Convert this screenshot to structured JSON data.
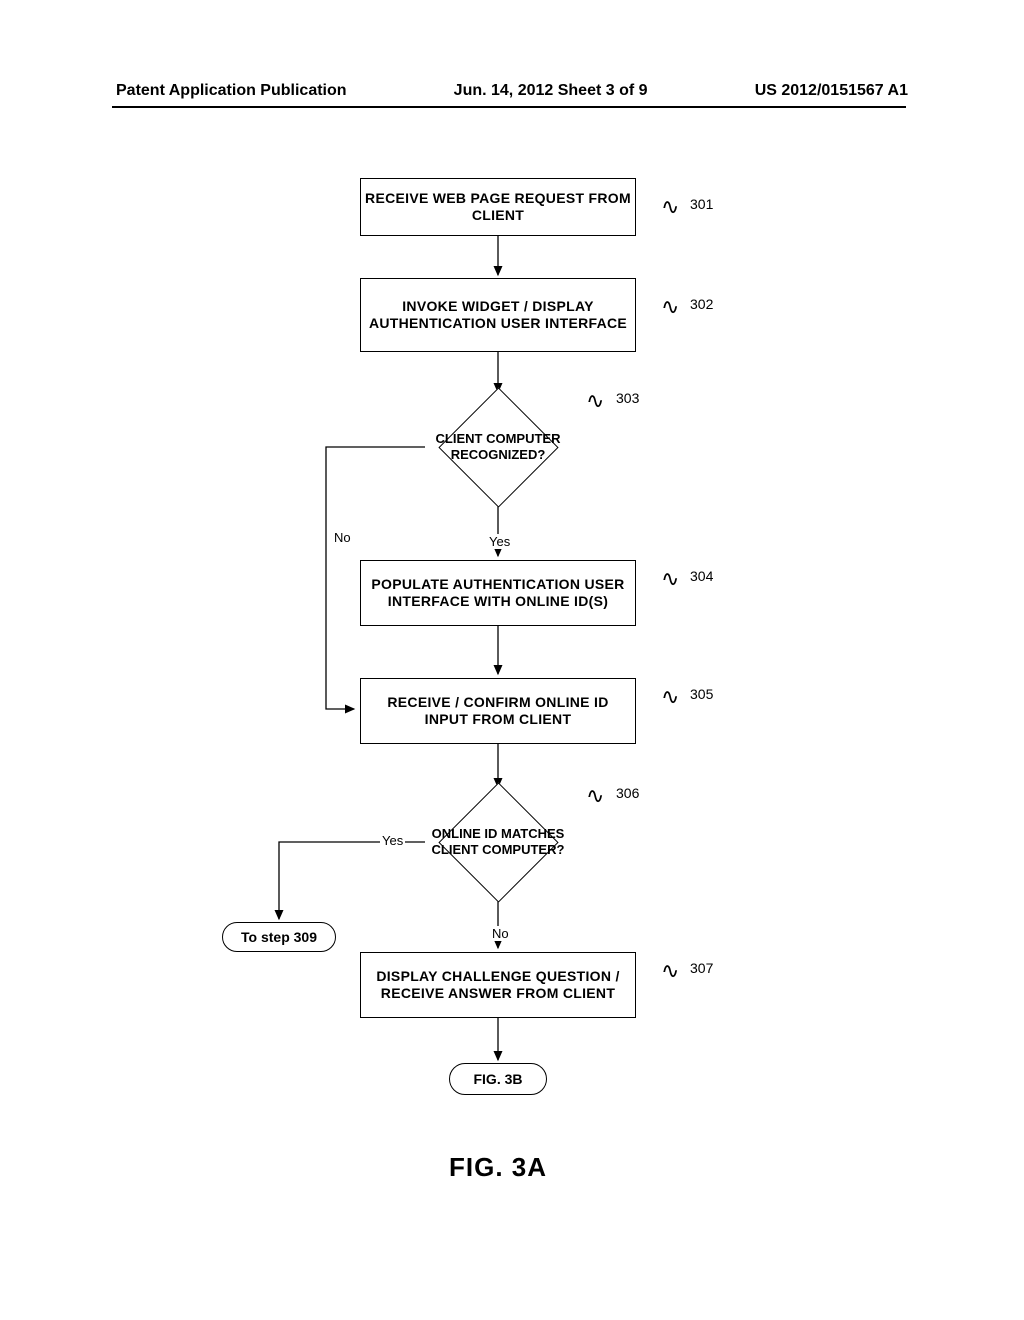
{
  "header": {
    "left": "Patent Application Publication",
    "center": "Jun. 14, 2012  Sheet 3 of 9",
    "right": "US 2012/0151567 A1"
  },
  "flowchart": {
    "box301": "RECEIVE WEB PAGE REQUEST FROM CLIENT",
    "box302": "INVOKE WIDGET / DISPLAY AUTHENTICATION USER INTERFACE",
    "diamond303": "CLIENT COMPUTER RECOGNIZED?",
    "box304": "POPULATE AUTHENTICATION USER INTERFACE WITH ONLINE ID(S)",
    "box305": "RECEIVE / CONFIRM ONLINE ID INPUT FROM CLIENT",
    "diamond306": "ONLINE ID MATCHES CLIENT COMPUTER?",
    "box307": "DISPLAY CHALLENGE QUESTION / RECEIVE ANSWER FROM CLIENT",
    "pillStep309": "To step 309",
    "pillFig3B": "FIG. 3B"
  },
  "edges": {
    "yes303": "Yes",
    "no303": "No",
    "yes306": "Yes",
    "no306": "No"
  },
  "refs": {
    "r301": "301",
    "r302": "302",
    "r303": "303",
    "r304": "304",
    "r305": "305",
    "r306": "306",
    "r307": "307"
  },
  "caption": "FIG. 3A"
}
